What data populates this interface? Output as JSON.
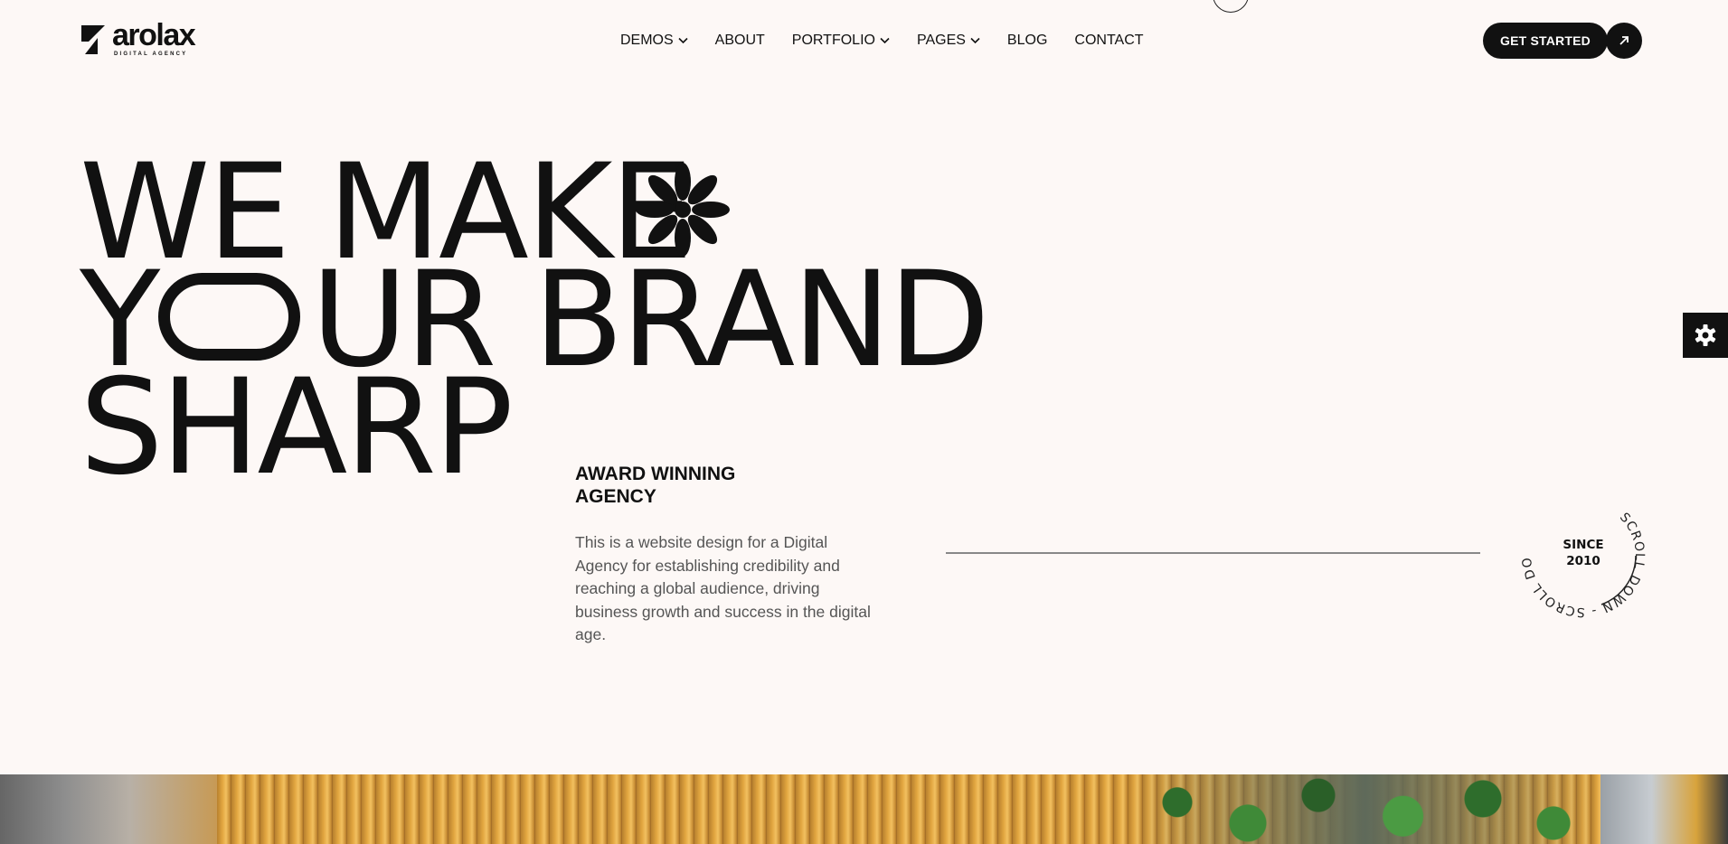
{
  "brand": {
    "name": "arolax",
    "tagline": "DIGITAL AGENCY"
  },
  "nav": {
    "items": [
      {
        "label": "DEMOS",
        "has_dropdown": true
      },
      {
        "label": "ABOUT",
        "has_dropdown": false
      },
      {
        "label": "PORTFOLIO",
        "has_dropdown": true
      },
      {
        "label": "PAGES",
        "has_dropdown": true
      },
      {
        "label": "BLOG",
        "has_dropdown": false
      },
      {
        "label": "CONTACT",
        "has_dropdown": false
      }
    ]
  },
  "header": {
    "cta_label": "GET STARTED",
    "cta_icon": "arrow-up-right-icon"
  },
  "hero": {
    "line1": "WE MAKE",
    "line2_y": "Y",
    "line2_rest": "UR BRAND",
    "line3": "SHARP",
    "award": "AWARD WINNING AGENCY",
    "description": "This is a website design for a Digital Agency for establishing credibility and reaching a global audience, driving business growth and success in the digital age."
  },
  "scroll_badge": {
    "ring_text": "SCROLL DOWN - SCROLL DOWN",
    "since_label": "SINCE",
    "year": "2010"
  },
  "settings": {
    "icon": "gear-icon"
  },
  "colors": {
    "background": "#fdf8f6",
    "text": "#111111",
    "muted_text": "#555555",
    "rule": "#888888"
  }
}
